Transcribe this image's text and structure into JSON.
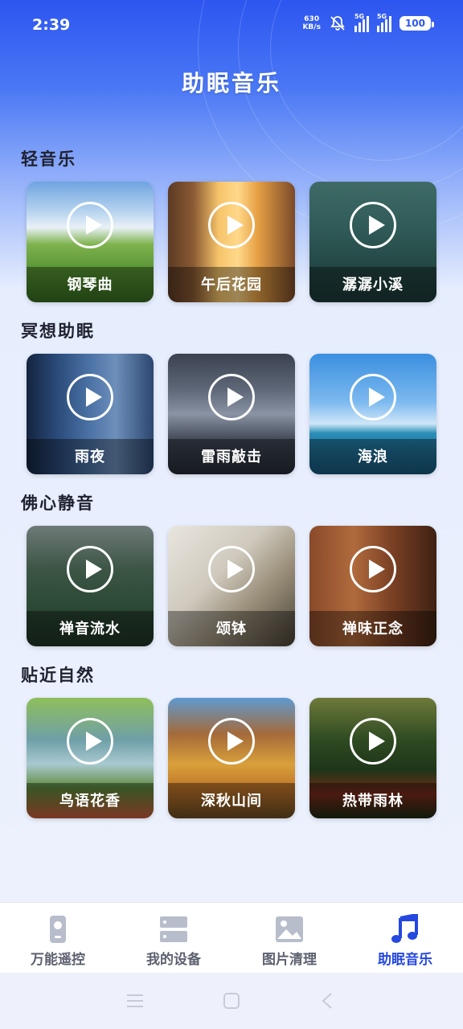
{
  "status_bar": {
    "time": "2:39",
    "net_speed_value": "630",
    "net_speed_unit": "KB/s",
    "signal_1": "5G",
    "signal_2": "5G",
    "battery": "100"
  },
  "header": {
    "title": "助眠音乐"
  },
  "sections": [
    {
      "title": "轻音乐",
      "items": [
        {
          "label": "钢琴曲"
        },
        {
          "label": "午后花园"
        },
        {
          "label": "潺潺小溪"
        }
      ]
    },
    {
      "title": "冥想助眠",
      "items": [
        {
          "label": "雨夜"
        },
        {
          "label": "雷雨敲击"
        },
        {
          "label": "海浪"
        }
      ]
    },
    {
      "title": "佛心静音",
      "items": [
        {
          "label": "禅音流水"
        },
        {
          "label": "颂钵"
        },
        {
          "label": "禅味正念"
        }
      ]
    },
    {
      "title": "贴近自然",
      "items": [
        {
          "label": "鸟语花香"
        },
        {
          "label": "深秋山间"
        },
        {
          "label": "热带雨林"
        }
      ]
    }
  ],
  "bottom_nav": {
    "items": [
      {
        "label": "万能遥控",
        "icon": "remote-icon"
      },
      {
        "label": "我的设备",
        "icon": "devices-icon"
      },
      {
        "label": "图片清理",
        "icon": "image-icon"
      },
      {
        "label": "助眠音乐",
        "icon": "music-note-icon"
      }
    ],
    "active_index": 3
  },
  "colors": {
    "accent": "#2448e0",
    "header_blue": "#2d55f0",
    "inactive": "#5d6170"
  }
}
